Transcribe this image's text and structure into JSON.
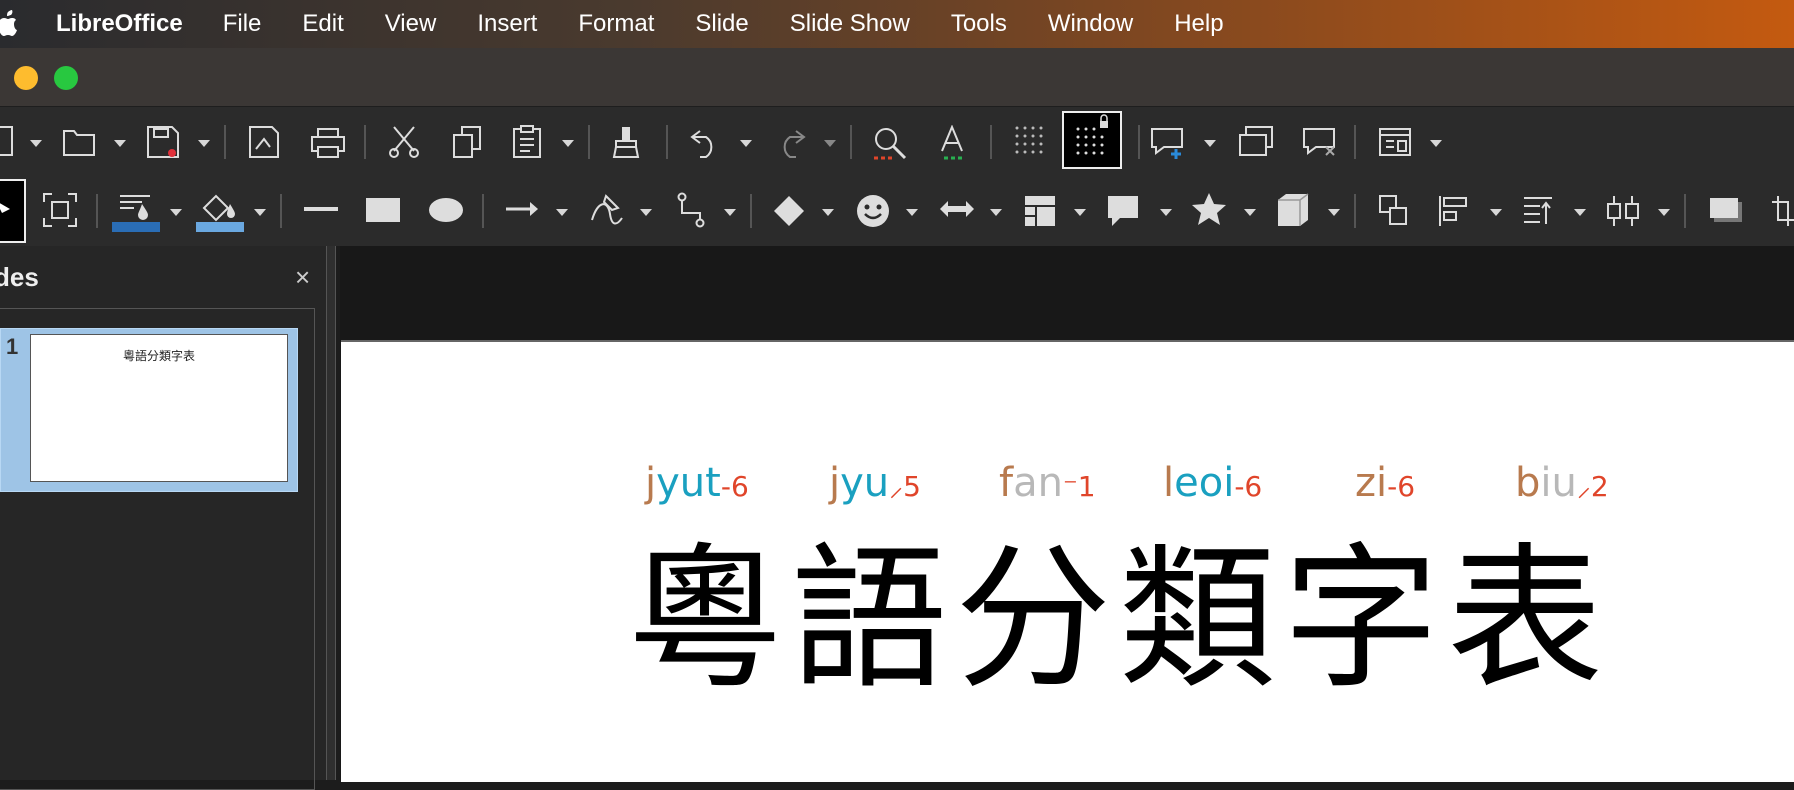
{
  "menubar": {
    "app_name": "LibreOffice",
    "items": [
      "File",
      "Edit",
      "View",
      "Insert",
      "Format",
      "Slide",
      "Slide Show",
      "Tools",
      "Window",
      "Help"
    ]
  },
  "window": {
    "traffic_lights": [
      "minimize",
      "zoom"
    ],
    "colors": {
      "minimize": "#febc2e",
      "zoom": "#28c840"
    }
  },
  "toolbar_standard": {
    "icons": [
      "new-icon",
      "open-icon",
      "save-icon",
      "export-pdf-icon",
      "print-icon",
      "cut-icon",
      "copy-icon",
      "paste-icon",
      "clone-formatting-icon",
      "undo-icon",
      "redo-icon",
      "find-replace-icon",
      "spelling-icon",
      "display-grid-icon",
      "snap-to-grid-icon",
      "new-slide-icon",
      "duplicate-slide-icon",
      "delete-slide-icon",
      "slide-layout-icon"
    ]
  },
  "toolbar_drawing": {
    "icons": [
      "select-icon",
      "zoom-pan-icon",
      "line-color-icon",
      "fill-color-icon",
      "line-icon",
      "rectangle-icon",
      "ellipse-icon",
      "arrow-line-icon",
      "curve-icon",
      "connector-icon",
      "basic-shapes-icon",
      "symbol-shapes-icon",
      "block-arrows-icon",
      "flowchart-icon",
      "callout-icon",
      "stars-icon",
      "3d-objects-icon",
      "transformations-icon",
      "align-icon",
      "arrange-icon",
      "distribute-icon",
      "shadow-icon",
      "crop-icon"
    ],
    "line_color": "#2a6db5",
    "fill_color": "#6aa8e0"
  },
  "slides_panel": {
    "title": "des",
    "close_label": "×",
    "slides": [
      {
        "number": "1",
        "title": "粵語分類字表"
      }
    ]
  },
  "slide": {
    "title": "粵語分類字表",
    "ruby": [
      {
        "initial": "j",
        "final": "yut",
        "tone": "-6"
      },
      {
        "initial": "j",
        "final": "yu",
        "tone": "⸝5"
      },
      {
        "initial": "f",
        "final": "an",
        "tone": "⁻1"
      },
      {
        "initial": "l",
        "final": "eoi",
        "tone": "-6"
      },
      {
        "initial": "z",
        "final": "i",
        "tone": "-6"
      },
      {
        "initial": "b",
        "final": "iu",
        "tone": "⸝2"
      }
    ],
    "colors": {
      "initial": "#b87a4e",
      "final": "#1aa0c0",
      "coda": "#b8b8b8",
      "tone": "#e0452a"
    }
  }
}
